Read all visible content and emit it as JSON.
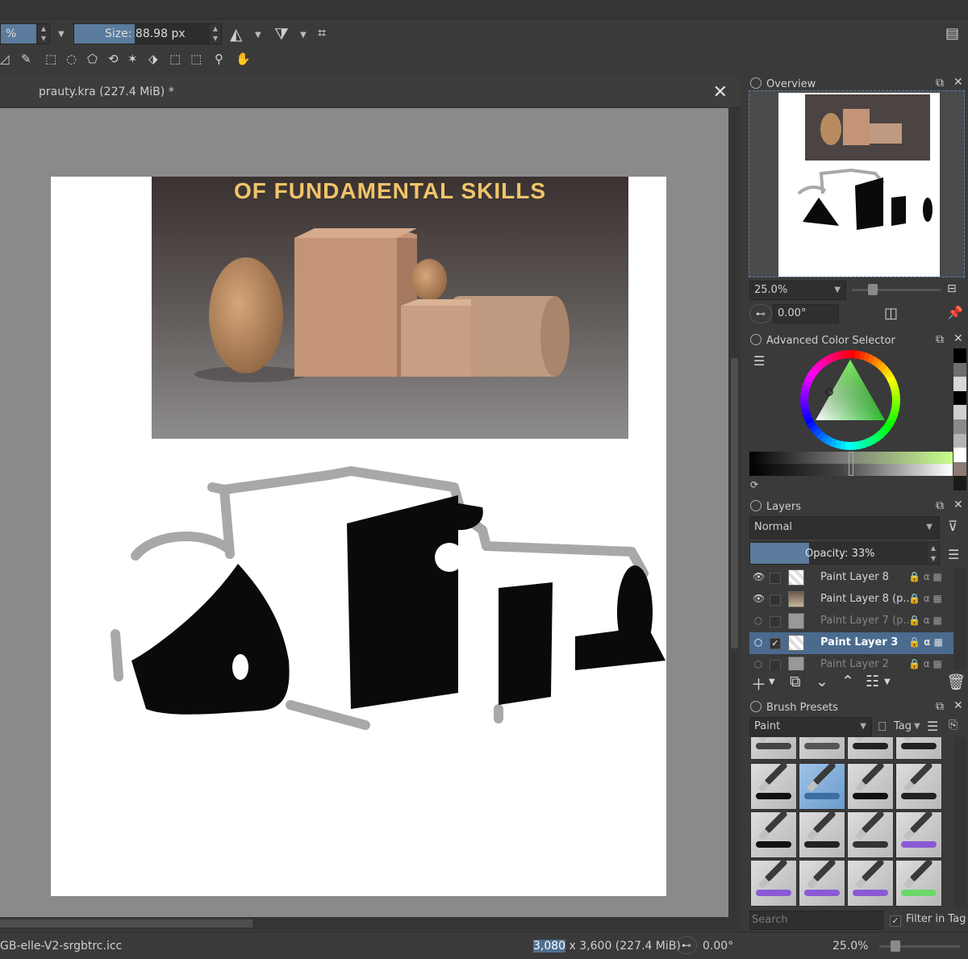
{
  "toolbar": {
    "opacity_suffix": "%",
    "size_label": "Size:",
    "size_value": "88.98 px"
  },
  "document": {
    "tab_title": "prauty.kra (227.4 MiB) *",
    "reference_title": "OF FUNDAMENTAL SKILLS"
  },
  "overview": {
    "title": "Overview",
    "zoom": "25.0%",
    "rotation": "0.00°"
  },
  "color_selector": {
    "title": "Advanced Color Selector",
    "history_colors": [
      "#000000",
      "#6e6e6e",
      "#d8d8d8",
      "#000000",
      "#cfcfcf",
      "#8a8a8a",
      "#b4b4b4",
      "#ffffff",
      "#8c7c73",
      "#1a1a1a"
    ]
  },
  "layers": {
    "title": "Layers",
    "blend_mode": "Normal",
    "opacity_label": "Opacity:",
    "opacity_value": "33%",
    "opacity_fraction": 0.33,
    "items": [
      {
        "name": "Paint Layer 8",
        "visible": true,
        "checked": false,
        "thumb": "checker",
        "state": "normal"
      },
      {
        "name": "Paint Layer 8 (p...",
        "visible": true,
        "checked": false,
        "thumb": "img",
        "state": "normal"
      },
      {
        "name": "Paint Layer 7 (p...",
        "visible": false,
        "checked": false,
        "thumb": "grey",
        "state": "dim"
      },
      {
        "name": "Paint Layer 3",
        "visible": false,
        "checked": true,
        "thumb": "checker",
        "state": "sel"
      },
      {
        "name": "Paint Layer 2",
        "visible": false,
        "checked": false,
        "thumb": "grey",
        "state": "dim"
      }
    ]
  },
  "brush_presets": {
    "title": "Brush Presets",
    "category": "Paint",
    "tag_label": "Tag",
    "search_placeholder": "Search",
    "filter_label": "Filter in Tag",
    "stroke_colors": [
      "#444",
      "#555",
      "#222",
      "#222",
      "#111",
      "#3b6fa3",
      "#111",
      "#222",
      "#111",
      "#222",
      "#333",
      "#8a5ad6",
      "#8a5ad6",
      "#8a5ad6",
      "#8a5ad6",
      "#6bd86b"
    ]
  },
  "status": {
    "profile": "GB-elle-V2-srgbtrc.icc",
    "dim_width": "3,080",
    "dim_rest": " x 3,600 (227.4 MiB)",
    "rotation": "0.00°",
    "zoom": "25.0%"
  }
}
